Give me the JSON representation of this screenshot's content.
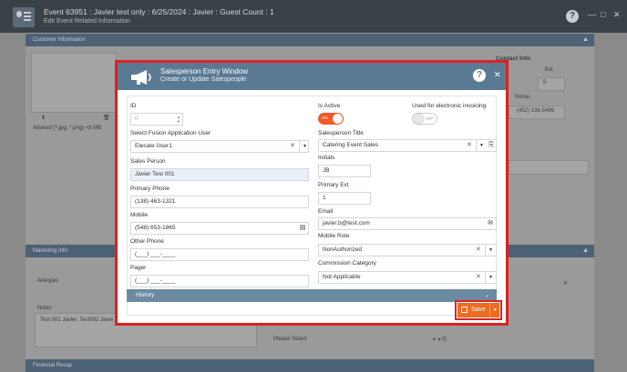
{
  "app": {
    "title": "Event 63951 : Javier test only : 6/25/2024 : Javier : Guest Count : 1",
    "subtitle": "Edit Event Related Information",
    "help_icon": "?",
    "minimize": "—",
    "maximize": "□",
    "close": "✕"
  },
  "background": {
    "customer_section": "Customer Information",
    "contact_info": "Contact Info",
    "ext_label": "Ext",
    "ext_value": "5",
    "home_label": "Home",
    "home_phone": "(452) 136-5496",
    "allowed_text": "Allowed (*.jpg, *.png) <8 MB",
    "marketing_section": "Marketing Info",
    "allergies_label": "Allergies",
    "notes_label": "Notes",
    "notes_value": "Test 001 Javier. Test002 Javie",
    "please_select": "Please Select",
    "financial_section": "Financial Recap"
  },
  "modal": {
    "title": "Salesperson Entry Window",
    "subtitle": "Create or Update Salespeople",
    "help_icon": "?",
    "close_icon": "✕",
    "left": {
      "id_label": "ID",
      "id_value": "0",
      "app_user_label": "Select Fusion Application User",
      "app_user_value": "Elecate User1",
      "sales_person_label": "Sales Person",
      "sales_person_value": "Javier Test 001",
      "primary_phone_label": "Primary Phone",
      "primary_phone_value": "(138) 463-1321",
      "mobile_label": "Mobile",
      "mobile_value": "(548) 653-1865",
      "other_phone_label": "Other Phone",
      "other_phone_value": "(___) ___-____",
      "pager_label": "Pager",
      "pager_value": "(___) ___-____"
    },
    "right": {
      "is_active_label": "Is Active",
      "is_active_state": "ON",
      "invoicing_label": "Used for electronic invoicing",
      "invoicing_state": "OFF",
      "title_label": "Salesperson Title",
      "title_value": "Catering Event Sales",
      "initials_label": "Initials",
      "initials_value": "JB",
      "primary_ext_label": "Primary Ext",
      "primary_ext_value": "1",
      "email_label": "Email",
      "email_value": "javier.b@test.com",
      "mobile_role_label": "Mobile Role",
      "mobile_role_value": "NonAuthorized",
      "commission_label": "Commission Category",
      "commission_value": "Not Applicable"
    },
    "history_label": "History",
    "save_label": "Save"
  },
  "colors": {
    "modal_header": "#5a7a93",
    "accent_orange": "#ee6a1f",
    "highlight_red": "#e02020",
    "history_bar": "#6d8aa3"
  }
}
